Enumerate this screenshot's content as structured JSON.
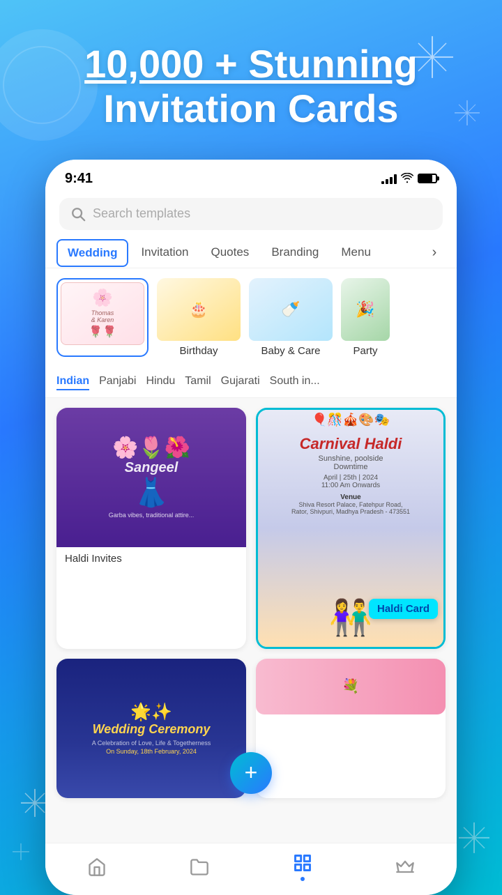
{
  "hero": {
    "title_line1": "10,000 + Stunning",
    "title_line2": "Invitation Cards"
  },
  "status_bar": {
    "time": "9:41",
    "signal": "●●●●",
    "wifi": "wifi",
    "battery": "battery"
  },
  "search": {
    "placeholder": "Search templates"
  },
  "tabs": {
    "items": [
      {
        "label": "Wedding",
        "active": true
      },
      {
        "label": "Invitation",
        "active": false
      },
      {
        "label": "Quotes",
        "active": false
      },
      {
        "label": "Branding",
        "active": false
      },
      {
        "label": "Menu",
        "active": false
      }
    ]
  },
  "template_categories": [
    {
      "label": "",
      "selected": true,
      "emoji": "🌸"
    },
    {
      "label": "Birthday",
      "selected": false,
      "emoji": "🎂"
    },
    {
      "label": "Baby & Care",
      "selected": false,
      "emoji": "🍼"
    },
    {
      "label": "Party",
      "selected": false,
      "emoji": "🎉"
    }
  ],
  "subcategories": [
    {
      "label": "Indian",
      "active": true
    },
    {
      "label": "Panjabi",
      "active": false
    },
    {
      "label": "Hindu",
      "active": false
    },
    {
      "label": "Tamil",
      "active": false
    },
    {
      "label": "Gujarati",
      "active": false
    },
    {
      "label": "South in...",
      "active": false
    }
  ],
  "cards": [
    {
      "label": "Haldi Invites",
      "type": "haldi1"
    },
    {
      "label": "Haldi Card",
      "type": "haldi2",
      "highlighted": true,
      "badge": "Haldi Card"
    },
    {
      "label": "",
      "type": "wedding_ceremony"
    },
    {
      "label": "",
      "type": "partial"
    }
  ],
  "fab": {
    "label": "+"
  },
  "bottom_nav": {
    "items": [
      {
        "label": "home",
        "icon": "🏠",
        "active": false
      },
      {
        "label": "folder",
        "icon": "📁",
        "active": false
      },
      {
        "label": "grid",
        "icon": "⊞",
        "active": true
      },
      {
        "label": "crown",
        "icon": "👑",
        "active": false
      }
    ]
  }
}
